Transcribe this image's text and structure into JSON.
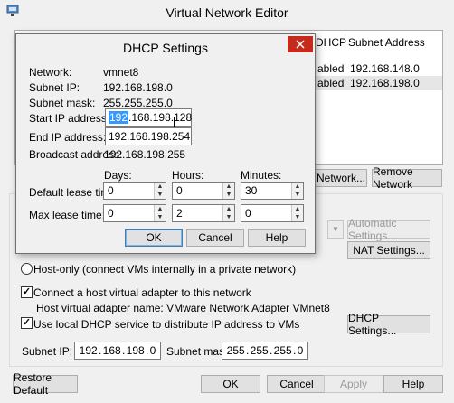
{
  "vne": {
    "title": "Virtual Network Editor",
    "table": {
      "headers": [
        "DHCP",
        "Subnet Address"
      ],
      "rows": [
        {
          "dhcp": "abled",
          "subnet": "192.168.148.0"
        },
        {
          "dhcp": "abled",
          "subnet": "192.168.198.0"
        }
      ]
    },
    "add_network_label": "Network...",
    "remove_network_label": "Remove Network",
    "automatic_settings_label": "Automatic Settings...",
    "nat_settings_label": "NAT Settings...",
    "host_only_label": "Host-only (connect VMs internally in a private network)",
    "connect_adapter_label": "Connect a host virtual adapter to this network",
    "adapter_name_label": "Host virtual adapter name: VMware Network Adapter VMnet8",
    "use_dhcp_label": "Use local DHCP service to distribute IP address to VMs",
    "dhcp_settings_label": "DHCP Settings...",
    "subnet_ip_label": "Subnet IP:",
    "subnet_ip": [
      "192",
      "168",
      "198",
      "0"
    ],
    "subnet_mask_label": "Subnet mask:",
    "subnet_mask": [
      "255",
      "255",
      "255",
      "0"
    ],
    "restore_default_label": "Restore Default",
    "ok_label": "OK",
    "cancel_label": "Cancel",
    "apply_label": "Apply",
    "help_label": "Help"
  },
  "dhcp": {
    "title": "DHCP Settings",
    "network_label": "Network:",
    "network_value": "vmnet8",
    "subnet_ip_label": "Subnet IP:",
    "subnet_ip_value": "192.168.198.0",
    "subnet_mask_label": "Subnet mask:",
    "subnet_mask_value": "255.255.255.0",
    "start_ip_label": "Start IP address:",
    "start_ip": [
      "192",
      "168",
      "198",
      "128"
    ],
    "end_ip_label": "End IP address:",
    "end_ip": [
      "192",
      "168",
      "198",
      "254"
    ],
    "broadcast_label": "Broadcast address:",
    "broadcast_value": "192.168.198.255",
    "days_label": "Days:",
    "hours_label": "Hours:",
    "minutes_label": "Minutes:",
    "default_lease_label": "Default lease time:",
    "default_lease": {
      "days": "0",
      "hours": "0",
      "minutes": "30"
    },
    "max_lease_label": "Max lease time:",
    "max_lease": {
      "days": "0",
      "hours": "2",
      "minutes": "0"
    },
    "ok_label": "OK",
    "cancel_label": "Cancel",
    "help_label": "Help"
  },
  "icons": {
    "app": "vmware-network-icon",
    "close": "close-icon",
    "spin_up": "▲",
    "spin_down": "▼",
    "check": "✓",
    "dot": "."
  },
  "colors": {
    "close_red": "#c42b1c",
    "selection": "#3399ff",
    "row_highlight": "#e6e6e6"
  }
}
